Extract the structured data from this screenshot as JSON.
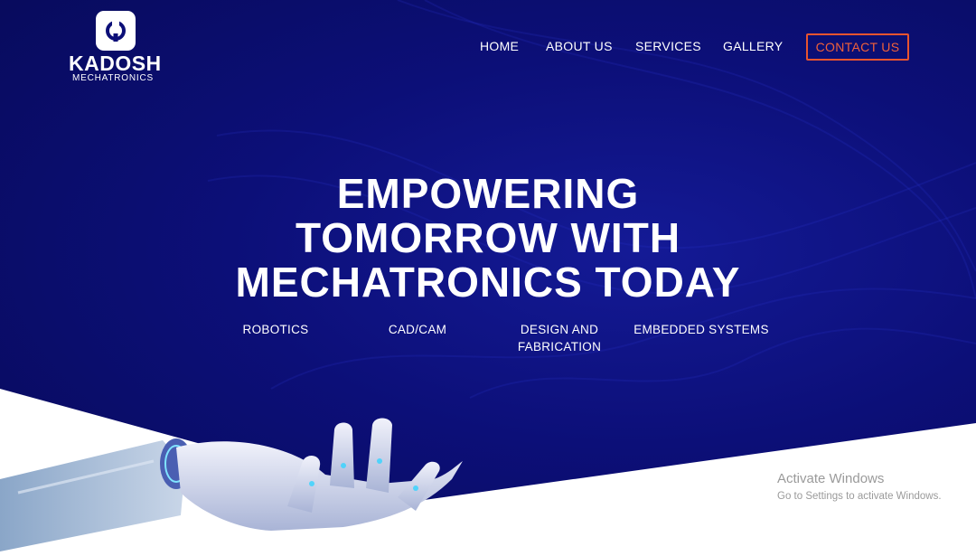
{
  "brand": {
    "name": "KADOSH",
    "subtitle": "MECHATRONICS",
    "logo_icon": "robot-hand-icon",
    "colors": {
      "primary_navy": "#0c0f78",
      "accent_orange": "#e8542f"
    }
  },
  "nav": {
    "items": [
      "HOME",
      "ABOUT US",
      "SERVICES",
      "GALLERY"
    ],
    "contact_label": "CONTACT US"
  },
  "hero": {
    "headline_lines": [
      "EMPOWERING",
      "TOMORROW WITH",
      "MECHATRONICS TODAY"
    ],
    "services": [
      "ROBOTICS",
      "CAD/CAM",
      "DESIGN AND",
      "FABRICATION",
      "EMBEDDED SYSTEMS"
    ],
    "image": "robotic-hand-illustration"
  },
  "watermark": {
    "title": "Activate Windows",
    "subtitle": "Go to Settings to activate Windows."
  }
}
